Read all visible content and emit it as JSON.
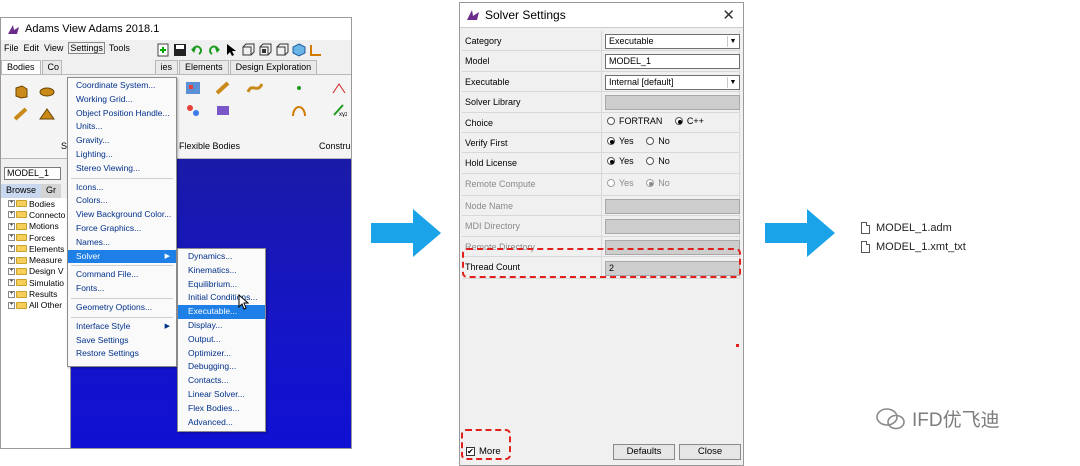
{
  "adams": {
    "title": "Adams View Adams 2018.1",
    "menubar": [
      "File",
      "Edit",
      "View",
      "Settings",
      "Tools"
    ],
    "ribbon_tabs": [
      "Bodies",
      "Co",
      "ies",
      "Elements",
      "Design Exploration"
    ],
    "group_labels": [
      "S",
      "Flexible Bodies",
      "Construc"
    ],
    "model_box": "MODEL_1",
    "browse_tabs": [
      "Browse",
      "Gr"
    ],
    "tree": [
      "Bodies",
      "Connecto",
      "Motions",
      "Forces",
      "Elements",
      "Measure",
      "Design V",
      "Simulatio",
      "Results",
      "All Other"
    ]
  },
  "settings_menu": {
    "group1": [
      "Coordinate System...",
      "Working Grid...",
      "Object Position Handle...",
      "Units...",
      "Gravity...",
      "Lighting...",
      "Stereo Viewing..."
    ],
    "group2": [
      "Icons...",
      "Colors...",
      "View Background Color...",
      "Force Graphics...",
      "Names..."
    ],
    "solver_item": "Solver",
    "group3": [
      "Command File...",
      "Fonts..."
    ],
    "group4": [
      "Geometry Options..."
    ],
    "group5": [
      "Interface Style",
      "Save Settings",
      "Restore Settings"
    ]
  },
  "solver_menu": {
    "items": [
      "Dynamics...",
      "Kinematics...",
      "Equilibrium...",
      "Initial Conditions...",
      "Executable...",
      "Display...",
      "Output...",
      "Optimizer...",
      "Debugging...",
      "Contacts...",
      "Linear Solver...",
      "Flex Bodies...",
      "Advanced..."
    ],
    "highlighted": "Executable..."
  },
  "dialog": {
    "title": "Solver Settings",
    "fields": {
      "category": {
        "label": "Category",
        "value": "Executable"
      },
      "model": {
        "label": "Model",
        "value": "MODEL_1"
      },
      "executable": {
        "label": "Executable",
        "value": "Internal  [default]"
      },
      "solver_library": {
        "label": "Solver Library",
        "value": ""
      },
      "choice": {
        "label": "Choice",
        "options": [
          "FORTRAN",
          "C++"
        ],
        "selected": "C++"
      },
      "verify_first": {
        "label": "Verify First",
        "options": [
          "Yes",
          "No"
        ],
        "selected": "Yes"
      },
      "hold_license": {
        "label": "Hold License",
        "options": [
          "Yes",
          "No"
        ],
        "selected": "Yes"
      },
      "remote_compute": {
        "label": "Remote Compute",
        "options": [
          "Yes",
          "No"
        ],
        "selected": "No"
      },
      "node_name": {
        "label": "Node Name",
        "value": ""
      },
      "mdi_directory": {
        "label": "MDI Directory",
        "value": ""
      },
      "remote_directory": {
        "label": "Remote Directory",
        "value": ""
      },
      "thread_count": {
        "label": "Thread Count",
        "value": "2"
      }
    },
    "more_label": "More",
    "more_checked": true,
    "defaults_label": "Defaults",
    "close_label": "Close"
  },
  "files": [
    "MODEL_1.adm",
    "MODEL_1.xmt_txt"
  ],
  "watermark": "IFD优飞迪",
  "colors": {
    "arrow": "#1aa3e8",
    "highlight": "#e0201a",
    "menu_selected": "#1e7fe6",
    "canvas": "#1515c8"
  }
}
